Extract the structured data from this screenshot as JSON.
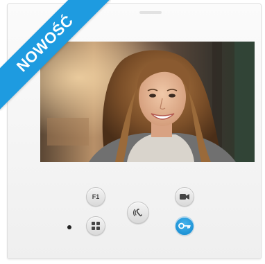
{
  "badge": {
    "label": "NOWOŚĆ",
    "color": "#1e9be0"
  },
  "panel": {
    "accent": "#1e93d6",
    "buttons": {
      "f1": {
        "label": "F1",
        "icon": "f1-function-icon"
      },
      "camera": {
        "icon": "camera-icon"
      },
      "talk": {
        "icon": "handset-talk-icon"
      },
      "menu": {
        "icon": "grid-menu-icon"
      },
      "door": {
        "icon": "key-door-open-icon"
      }
    },
    "indicator": {
      "icon": "status-led"
    }
  }
}
